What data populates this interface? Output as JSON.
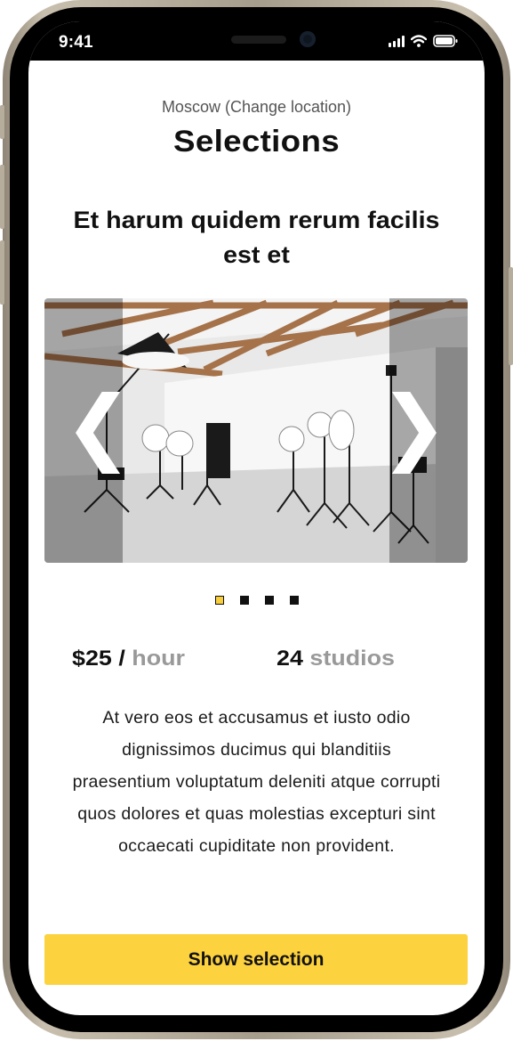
{
  "status_bar": {
    "time": "9:41"
  },
  "header": {
    "location": "Moscow (Change location)",
    "title": "Selections"
  },
  "card": {
    "headline": "Et harum quidem rerum facilis est et",
    "carousel": {
      "prev_glyph": "❮",
      "next_glyph": "❯",
      "slide_count": 4,
      "active_slide": 1
    },
    "stats": {
      "price": "$25",
      "price_separator": " / ",
      "price_unit": "hour",
      "studios_count": "24",
      "studios_label": "studios"
    },
    "description": "At vero eos et accusamus et iusto odio dignissimos ducimus qui blanditiis praesentium voluptatum deleniti atque corrupti quos dolores et quas molestias excepturi sint occaecati cupiditate non provident.",
    "button_label": "Show selection"
  },
  "colors": {
    "accent": "#fdd23f",
    "text": "#111111",
    "muted": "#999999"
  }
}
